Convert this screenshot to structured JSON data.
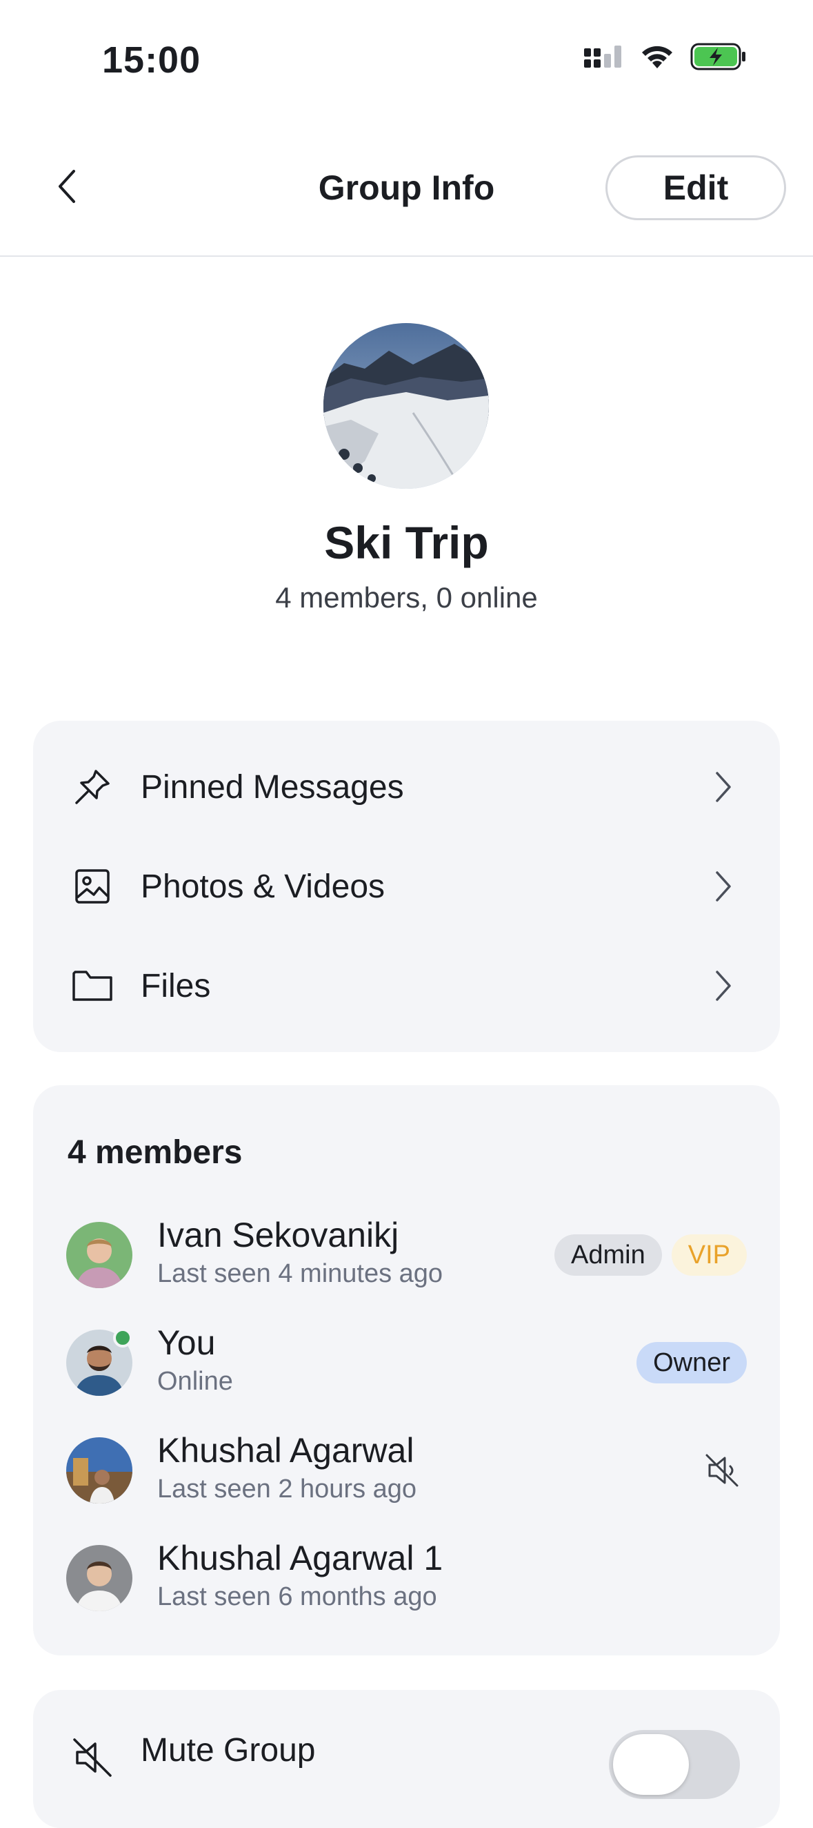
{
  "status_bar": {
    "time": "15:00",
    "icons": [
      "cellular-signal-icon",
      "wifi-icon",
      "battery-charging-icon"
    ]
  },
  "nav": {
    "title": "Group Info",
    "edit_label": "Edit",
    "back_icon": "chevron-left-icon"
  },
  "group": {
    "name": "Ski Trip",
    "subtitle": "4 members, 0 online"
  },
  "media_links": [
    {
      "icon": "pin-icon",
      "label": "Pinned Messages"
    },
    {
      "icon": "image-icon",
      "label": "Photos & Videos"
    },
    {
      "icon": "folder-icon",
      "label": "Files"
    }
  ],
  "members": {
    "heading": "4 members",
    "list": [
      {
        "name": "Ivan Sekovanikj",
        "status": "Last seen 4 minutes ago",
        "badges": [
          "Admin",
          "VIP"
        ]
      },
      {
        "name": "You",
        "status": "Online",
        "badges": [
          "Owner"
        ]
      },
      {
        "name": "Khushal Agarwal",
        "status": "Last seen 2 hours ago",
        "muted_icon": "speaker-muted-icon"
      },
      {
        "name": "Khushal Agarwal 1",
        "status": "Last seen 6 months ago"
      }
    ]
  },
  "settings": {
    "mute_label": "Mute Group",
    "mute_enabled": false
  },
  "colors": {
    "accent_online": "#3fa45a",
    "vip_text": "#e9a22a",
    "owner_badge_bg": "#c9daf8",
    "card_bg": "#f4f5f8",
    "battery_green": "#4cc552"
  }
}
